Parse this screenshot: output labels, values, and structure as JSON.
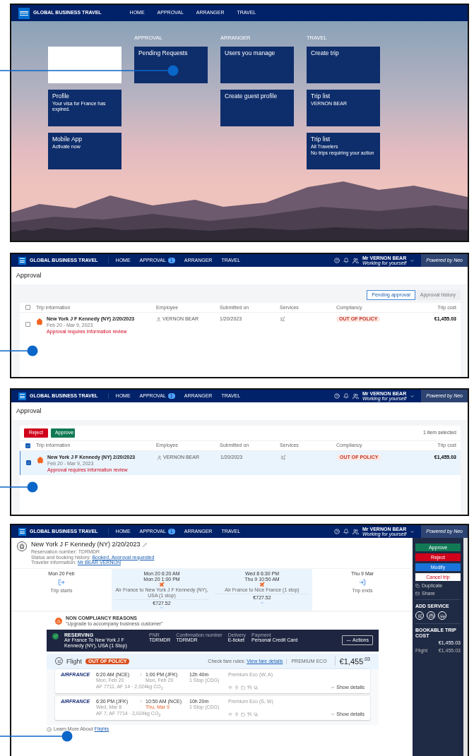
{
  "home_screen": {
    "nav": {
      "brand": "GLOBAL BUSINESS TRAVEL",
      "items": [
        {
          "label": "HOME"
        },
        {
          "label": "APPROVAL"
        },
        {
          "label": "ARRANGER"
        },
        {
          "label": "TRAVEL"
        }
      ]
    },
    "columns": [
      {
        "tiles": [
          {
            "kind": "blank"
          },
          {
            "kind": "link",
            "title": "Profile",
            "lines": [
              "Your visa for France has expired."
            ]
          },
          {
            "kind": "link",
            "title": "Mobile App",
            "lines": [
              "Activate now"
            ]
          }
        ]
      },
      {
        "heading": "APPROVAL",
        "tiles": [
          {
            "kind": "link",
            "title": "Pending Requests"
          }
        ]
      },
      {
        "heading": "ARRANGER",
        "tiles": [
          {
            "kind": "link",
            "title": "Users you manage"
          },
          {
            "kind": "link",
            "title": "Create guest profile"
          }
        ]
      },
      {
        "heading": "TRAVEL",
        "tiles": [
          {
            "kind": "link",
            "title": "Create trip"
          },
          {
            "kind": "link",
            "title": "Trip list",
            "lines": [
              "VERNON BEAR"
            ]
          },
          {
            "kind": "link",
            "title": "Trip list",
            "lines": [
              "All Travelers",
              "No trips requiring your action"
            ]
          }
        ]
      }
    ]
  },
  "approval_screens": [
    {
      "nav": {
        "brand": "GLOBAL BUSINESS TRAVEL",
        "items": [
          {
            "label": "HOME"
          },
          {
            "label": "APPROVAL",
            "badge": "1"
          },
          {
            "label": "ARRANGER"
          },
          {
            "label": "TRAVEL"
          }
        ],
        "user_name": "Mr VERNON BEAR",
        "user_role": "Working for yourself",
        "powered_by": "Powered by Neo"
      },
      "title": "Approval",
      "tabs": [
        {
          "label": "Pending approval",
          "selected": true
        },
        {
          "label": "Approval history",
          "selected": false
        }
      ],
      "all_checked": false,
      "columns": [
        "Trip information",
        "Employee",
        "Submitted on",
        "Services",
        "Compliancy",
        "Trip cost"
      ],
      "rows": [
        {
          "trip": "New York J F Kennedy (NY) 2/20/2023",
          "dates": "Feb 20 - Mar 9, 2023",
          "alert": "Approval requires information review",
          "employee": "VERNON BEAR",
          "submitted": "1/20/2023",
          "compliancy": "OUT OF POLICY",
          "cost": "€1,455.03",
          "checked": false,
          "selected": false
        }
      ]
    },
    {
      "nav": {
        "brand": "GLOBAL BUSINESS TRAVEL",
        "items": [
          {
            "label": "HOME"
          },
          {
            "label": "APPROVAL",
            "badge": "1"
          },
          {
            "label": "ARRANGER"
          },
          {
            "label": "TRAVEL"
          }
        ],
        "user_name": "Mr VERNON BEAR",
        "user_role": "Working for yourself",
        "powered_by": "Powered by Neo"
      },
      "title": "Approval",
      "actions": [
        {
          "kind": "reject",
          "label": "Reject"
        },
        {
          "kind": "approve",
          "label": "Approve"
        }
      ],
      "selection_count": "1 item selected",
      "all_checked": true,
      "columns": [
        "Trip information",
        "Employee",
        "Submitted on",
        "Services",
        "Compliancy",
        "Trip cost"
      ],
      "rows": [
        {
          "trip": "New York J F Kennedy (NY) 2/20/2023",
          "dates": "Feb 20 - Mar 9, 2023",
          "alert": "Approval requires information review",
          "employee": "VERNON BEAR",
          "submitted": "1/20/2023",
          "compliancy": "OUT OF POLICY",
          "cost": "€1,455.03",
          "checked": true,
          "selected": true
        }
      ]
    }
  ],
  "trip_screen": {
    "nav": {
      "brand": "GLOBAL BUSINESS TRAVEL",
      "items": [
        {
          "label": "HOME"
        },
        {
          "label": "APPROVAL",
          "badge": "1"
        },
        {
          "label": "ARRANGER"
        },
        {
          "label": "TRAVEL"
        }
      ],
      "user_name": "Mr VERNON BEAR",
      "user_role": "Working for yourself",
      "powered_by": "Powered by Neo"
    },
    "title": "New York J F Kennedy (NY) 2/20/2023",
    "reservation": "Reservation number: TDRMDR",
    "status_label": "Status and booking history:",
    "status_link": "Booked, Approval requested",
    "traveler_label": "Traveler information:",
    "traveler_link": "Mr BEAR VERNON",
    "timeline": [
      {
        "kind": "start",
        "date": "Mon 20 Feb",
        "label": "Trip starts",
        "selected": false
      },
      {
        "kind": "flight",
        "times": [
          "Mon 20 6:20 AM",
          "Mon 20 1:00 PM"
        ],
        "label": "Air France to New York J F Kennedy (NY), USA (1 stop)",
        "price": "€727.52",
        "selected": true
      },
      {
        "kind": "flight",
        "times": [
          "Wed 8 6:30 PM",
          "Thu 9 10:50 AM"
        ],
        "label": "Air France to Nice France (1 stop)",
        "price": "€727.52",
        "selected": true
      },
      {
        "kind": "end",
        "date": "Thu 9 Mar",
        "label": "Trip ends",
        "selected": false
      }
    ],
    "compliance": {
      "heading": "NON COMPLIANCY REASONS",
      "reason": "\"Upgrade to accompany business customer\""
    },
    "reservation_bar": {
      "status": "RESERVING",
      "route": "Air France To New York J F Kennedy (NY), USA (1 Stop)",
      "fields": [
        {
          "label": "PNR",
          "value": "TDRMDR"
        },
        {
          "label": "Confirmation number",
          "value": "TDRMDR"
        },
        {
          "label": "Delivery",
          "value": "E-ticket"
        },
        {
          "label": "Payment",
          "value": "Personal Credit Card"
        }
      ],
      "action": "Actions"
    },
    "flight": {
      "title": "Flight",
      "badge": "OUT OF POLICY",
      "fare_label": "Check fare rules:",
      "fare_link": "View fare details",
      "cabin": "PREMIUM ECO",
      "price": "€1,455$^{.03}$",
      "segments": [
        {
          "airline": "AIRFRANCE",
          "depart": "6:20 AM (NCE)",
          "depart_date": "Mon, Feb 20",
          "arrive": "1:00 PM (JFK)",
          "arrive_date": "Mon, Feb 20",
          "arrive_date_changed": false,
          "duration": "12h 40m",
          "stops": "1 Stop (CDG)",
          "fare_class": "Premium Eco (W, A)",
          "flights": "AF 7711, AF 14 · 2,024kg CO$_{2}$",
          "details": "Show details"
        },
        {
          "airline": "AIRFRANCE",
          "depart": "6:30 PM (JFK)",
          "depart_date": "Wed, Mar 8",
          "arrive": "10:50 AM (NCE)",
          "arrive_date": "Thu, Mar 9",
          "arrive_date_changed": true,
          "duration": "10h 20m",
          "stops": "1 Stop (CDG)",
          "fare_class": "Premium Eco (S, W)",
          "flights": "AF 7, AF 7714 · 2,024kg CO$_{2}$",
          "details": "Show details"
        }
      ]
    },
    "learn_more": "Learn More About",
    "learn_more_link": "Flights",
    "sidebar": {
      "buttons": [
        {
          "kind": "approve",
          "label": "Approve"
        },
        {
          "kind": "reject",
          "label": "Reject"
        },
        {
          "kind": "modify",
          "label": "Modify"
        },
        {
          "kind": "cancel",
          "label": "Cancel trip"
        }
      ],
      "links": [
        {
          "kind": "duplicate",
          "label": "Duplicate"
        },
        {
          "kind": "share",
          "label": "Share"
        }
      ],
      "add_service": "ADD SERVICE",
      "services": [
        {
          "kind": "flight"
        },
        {
          "kind": "hotel"
        },
        {
          "kind": "car"
        }
      ],
      "cost_label": "BOOKABLE TRIP COST",
      "cost": "€1,455.03",
      "breakdown": [
        {
          "label": "Flight",
          "value": "€1,455.03"
        }
      ]
    }
  }
}
